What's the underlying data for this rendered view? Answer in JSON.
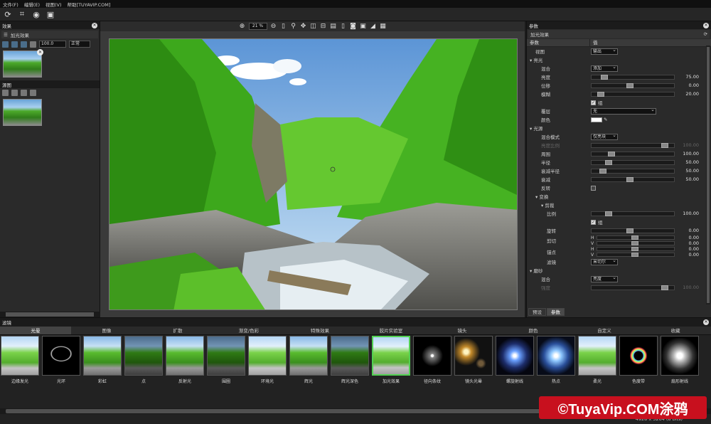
{
  "menu": [
    "文件(F)",
    "编辑(E)",
    "视图(V)",
    "帮助[TUYAVIP.COM]"
  ],
  "left": {
    "effects_title": "效果",
    "layer_name": "加光效果",
    "opacity_value": "100.0",
    "blend_mode": "正常",
    "source_title": "源图"
  },
  "center": {
    "zoom": "21 %"
  },
  "params": {
    "title": "参数",
    "effect_name": "加光效果",
    "col_param": "参数",
    "col_value": "值",
    "rows": [
      {
        "label": "视图",
        "kind": "dd",
        "value": "输出",
        "indent": 1
      },
      {
        "label": "亮光",
        "kind": "group",
        "indent": 0
      },
      {
        "label": "混合",
        "kind": "dd",
        "value": "添加",
        "indent": 2
      },
      {
        "label": "亮度",
        "kind": "slider",
        "pos": 0.12,
        "value": "75.00",
        "indent": 2
      },
      {
        "label": "位移",
        "kind": "slider",
        "pos": 0.46,
        "value": "0.00",
        "indent": 2
      },
      {
        "label": "模糊",
        "kind": "slider",
        "pos": 0.08,
        "value": "20.00",
        "indent": 2
      },
      {
        "label": "",
        "kind": "check",
        "value": "组",
        "indent": 2
      },
      {
        "label": "覆层",
        "kind": "dd2",
        "value": "无",
        "indent": 2
      },
      {
        "label": "颜色",
        "kind": "color",
        "indent": 2
      },
      {
        "label": "光源",
        "kind": "group",
        "indent": 0
      },
      {
        "label": "混合模式",
        "kind": "dd",
        "value": "仅亮块",
        "indent": 2
      },
      {
        "label": "亮度比例",
        "kind": "slider-dis",
        "pos": 0.92,
        "value": "100.00",
        "indent": 2
      },
      {
        "label": "周围",
        "kind": "slider",
        "pos": 0.22,
        "value": "100.00",
        "indent": 2
      },
      {
        "label": "半径",
        "kind": "slider",
        "pos": 0.18,
        "value": "50.00",
        "indent": 2
      },
      {
        "label": "衰减半径",
        "kind": "slider",
        "pos": 0.1,
        "value": "50.00",
        "indent": 2
      },
      {
        "label": "衰减",
        "kind": "slider",
        "pos": 0.46,
        "value": "50.00",
        "indent": 2
      },
      {
        "label": "反转",
        "kind": "checkbox",
        "indent": 2
      },
      {
        "label": "变换",
        "kind": "group",
        "indent": 1
      },
      {
        "label": "剪裁",
        "kind": "group",
        "indent": 2
      },
      {
        "label": "比例",
        "kind": "slider",
        "pos": 0.18,
        "value": "100.00",
        "indent": 3
      },
      {
        "label": "",
        "kind": "check",
        "value": "组",
        "indent": 3
      },
      {
        "label": "旋转",
        "kind": "slider",
        "pos": 0.46,
        "value": "0.00",
        "indent": 3
      },
      {
        "label": "剪切",
        "kind": "hv",
        "h": "0.00",
        "v": "0.00",
        "indent": 3
      },
      {
        "label": "锚点",
        "kind": "hv",
        "h": "0.00",
        "v": "0.00",
        "indent": 3
      },
      {
        "label": "滤镜",
        "kind": "dd",
        "value": "米切尔",
        "indent": 3
      },
      {
        "label": "磨砂",
        "kind": "group",
        "indent": 0
      },
      {
        "label": "混合",
        "kind": "dd",
        "value": "亮度",
        "indent": 2
      },
      {
        "label": "强度",
        "kind": "slider-dis",
        "pos": 0.92,
        "value": "100.00",
        "indent": 2
      }
    ],
    "bottom_tabs": [
      "预设",
      "参数"
    ]
  },
  "filters": {
    "title": "滤镜",
    "categories": [
      "光晕",
      "图像",
      "扩散",
      "渐变/色彩",
      "特殊效果",
      "胶片实验室",
      "镜头",
      "颜色",
      "自定义",
      "收藏"
    ],
    "active_category": 0,
    "items": [
      {
        "label": "边缘发光",
        "style": "land glow"
      },
      {
        "label": "光环",
        "style": "ring"
      },
      {
        "label": "彩虹",
        "style": "land"
      },
      {
        "label": "点",
        "style": "land dark"
      },
      {
        "label": "反射光",
        "style": "land"
      },
      {
        "label": "围圈",
        "style": "land dark"
      },
      {
        "label": "环境光",
        "style": "land glow"
      },
      {
        "label": "辉光",
        "style": "land"
      },
      {
        "label": "辉光深色",
        "style": "land dark"
      },
      {
        "label": "加光效果",
        "style": "land glow",
        "selected": true
      },
      {
        "label": "径向条纹",
        "style": "star"
      },
      {
        "label": "镜头光晕",
        "style": "flare"
      },
      {
        "label": "螺旋射线",
        "style": "burst"
      },
      {
        "label": "热点",
        "style": "hot"
      },
      {
        "label": "柔光",
        "style": "land glow"
      },
      {
        "label": "色度带",
        "style": "spectrum"
      },
      {
        "label": "扇形射线",
        "style": "fan"
      }
    ],
    "status": "4928 x 3264 (8 bits)"
  },
  "watermark": "©TuyaVip.COM涂鸦"
}
